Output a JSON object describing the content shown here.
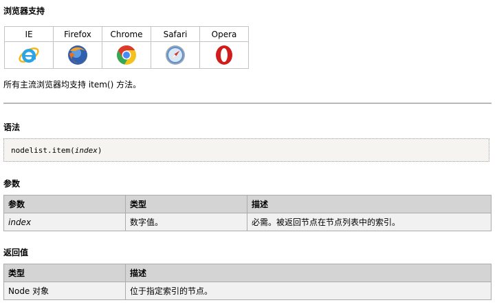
{
  "support": {
    "heading": "浏览器支持",
    "browsers": [
      {
        "name": "IE",
        "icon": "ie-icon"
      },
      {
        "name": "Firefox",
        "icon": "firefox-icon"
      },
      {
        "name": "Chrome",
        "icon": "chrome-icon"
      },
      {
        "name": "Safari",
        "icon": "safari-icon"
      },
      {
        "name": "Opera",
        "icon": "opera-icon"
      }
    ],
    "text": "所有主流浏览器均支持 item() 方法。"
  },
  "syntax": {
    "heading": "语法",
    "code_prefix": "nodelist.item(",
    "code_param": "index",
    "code_suffix": ")"
  },
  "params": {
    "heading": "参数",
    "headers": [
      "参数",
      "类型",
      "描述"
    ],
    "rows": [
      [
        "index",
        "数字值。",
        "必需。被返回节点在节点列表中的索引。"
      ]
    ]
  },
  "returns": {
    "heading": "返回值",
    "headers": [
      "类型",
      "描述"
    ],
    "rows": [
      [
        "Node 对象",
        "位于指定索引的节点。"
      ]
    ]
  }
}
